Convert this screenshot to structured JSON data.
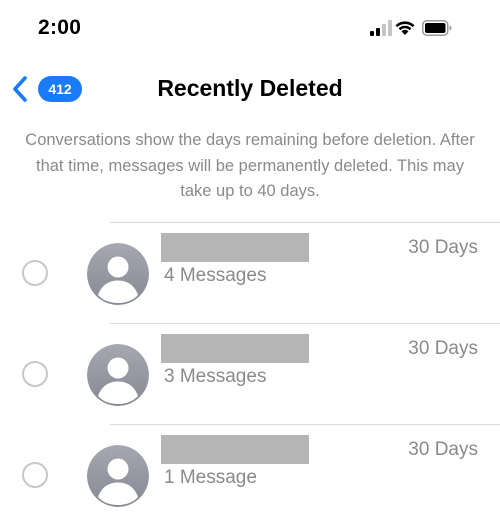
{
  "status_bar": {
    "time": "2:00",
    "icons": [
      "signal-icon",
      "wifi-icon",
      "battery-icon"
    ]
  },
  "nav": {
    "back_badge": "412",
    "title": "Recently Deleted"
  },
  "description": "Conversations show the days remaining before deletion. After that time, messages will be permanently deleted. This may take up to 40 days.",
  "conversations": [
    {
      "count": "4 Messages",
      "days": "30 Days"
    },
    {
      "count": "3 Messages",
      "days": "30 Days"
    },
    {
      "count": "1 Message",
      "days": "30 Days"
    }
  ],
  "colors": {
    "accent": "#1a7cf5",
    "secondary_text": "#8a8a8e",
    "redaction": "#b5b5b5"
  }
}
